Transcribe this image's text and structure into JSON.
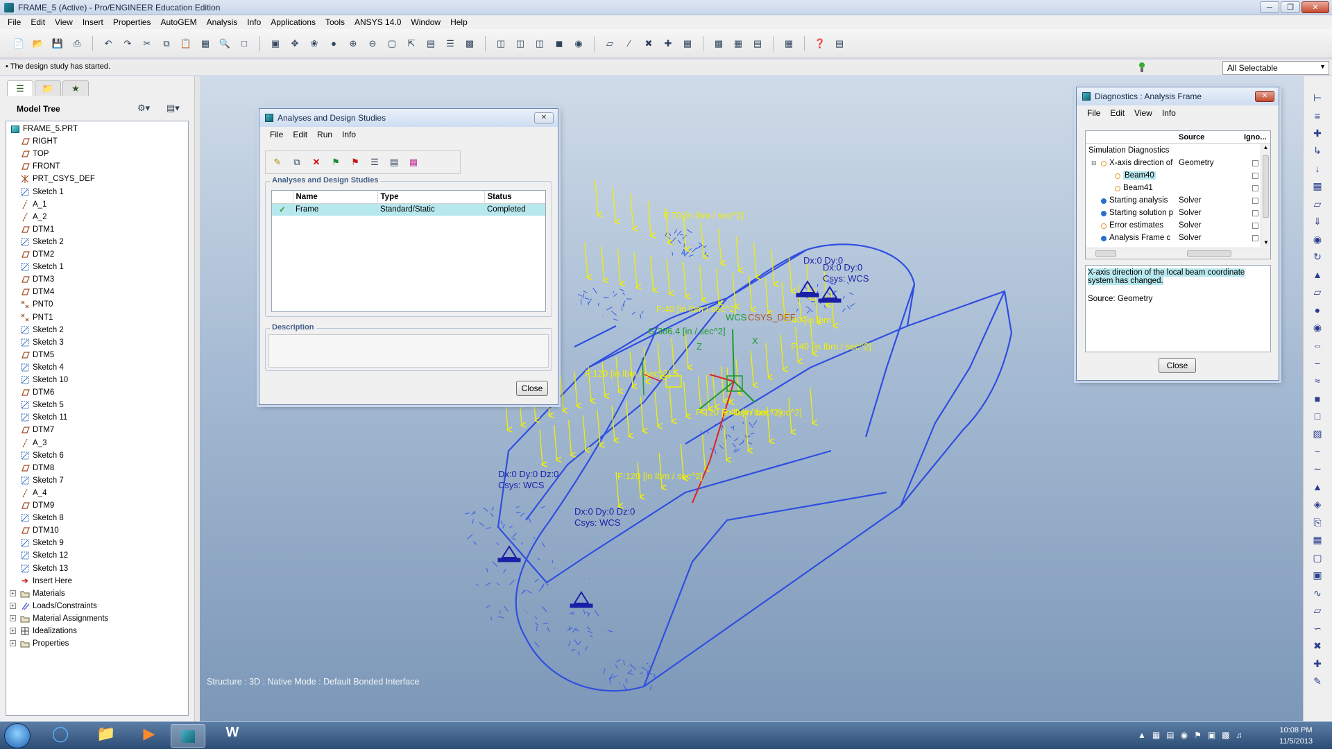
{
  "window": {
    "title": "FRAME_5 (Active) - Pro/ENGINEER Education Edition"
  },
  "menu": [
    "File",
    "Edit",
    "View",
    "Insert",
    "Properties",
    "AutoGEM",
    "Analysis",
    "Info",
    "Applications",
    "Tools",
    "ANSYS 14.0",
    "Window",
    "Help"
  ],
  "message": "The design study has started.",
  "filter": {
    "selected": "All Selectable"
  },
  "model_tree": {
    "header": "Model Tree",
    "items": [
      {
        "label": "FRAME_5.PRT",
        "icon": "part"
      },
      {
        "label": "RIGHT",
        "icon": "datum-plane"
      },
      {
        "label": "TOP",
        "icon": "datum-plane"
      },
      {
        "label": "FRONT",
        "icon": "datum-plane"
      },
      {
        "label": "PRT_CSYS_DEF",
        "icon": "csys"
      },
      {
        "label": "Sketch 1",
        "icon": "sketch"
      },
      {
        "label": "A_1",
        "icon": "axis"
      },
      {
        "label": "A_2",
        "icon": "axis"
      },
      {
        "label": "DTM1",
        "icon": "datum-plane"
      },
      {
        "label": "Sketch 2",
        "icon": "sketch"
      },
      {
        "label": "DTM2",
        "icon": "datum-plane"
      },
      {
        "label": "Sketch 1",
        "icon": "sketch"
      },
      {
        "label": "DTM3",
        "icon": "datum-plane"
      },
      {
        "label": "DTM4",
        "icon": "datum-plane"
      },
      {
        "label": "PNT0",
        "icon": "point"
      },
      {
        "label": "PNT1",
        "icon": "point"
      },
      {
        "label": "Sketch 2",
        "icon": "sketch"
      },
      {
        "label": "Sketch 3",
        "icon": "sketch"
      },
      {
        "label": "DTM5",
        "icon": "datum-plane"
      },
      {
        "label": "Sketch 4",
        "icon": "sketch"
      },
      {
        "label": "Sketch 10",
        "icon": "sketch"
      },
      {
        "label": "DTM6",
        "icon": "datum-plane"
      },
      {
        "label": "Sketch 5",
        "icon": "sketch"
      },
      {
        "label": "Sketch 11",
        "icon": "sketch"
      },
      {
        "label": "DTM7",
        "icon": "datum-plane"
      },
      {
        "label": "A_3",
        "icon": "axis"
      },
      {
        "label": "Sketch 6",
        "icon": "sketch"
      },
      {
        "label": "DTM8",
        "icon": "datum-plane"
      },
      {
        "label": "Sketch 7",
        "icon": "sketch"
      },
      {
        "label": "A_4",
        "icon": "axis"
      },
      {
        "label": "DTM9",
        "icon": "datum-plane"
      },
      {
        "label": "Sketch 8",
        "icon": "sketch"
      },
      {
        "label": "DTM10",
        "icon": "datum-plane"
      },
      {
        "label": "Sketch 9",
        "icon": "sketch"
      },
      {
        "label": "Sketch 12",
        "icon": "sketch"
      },
      {
        "label": "Sketch 13",
        "icon": "sketch"
      },
      {
        "label": "Insert Here",
        "icon": "insert-arrow"
      },
      {
        "label": "Materials",
        "icon": "folder"
      },
      {
        "label": "Loads/Constraints",
        "icon": "loads"
      },
      {
        "label": "Material Assignments",
        "icon": "folder"
      },
      {
        "label": "Idealizations",
        "icon": "idealization"
      },
      {
        "label": "Properties",
        "icon": "folder"
      }
    ]
  },
  "analyses_dialog": {
    "title": "Analyses and Design Studies",
    "menu": [
      "File",
      "Edit",
      "Run",
      "Info"
    ],
    "group_label": "Analyses and Design Studies",
    "columns": [
      "Name",
      "Type",
      "Status"
    ],
    "rows": [
      {
        "name": "Frame",
        "type": "Standard/Static",
        "status": "Completed"
      }
    ],
    "description_label": "Description",
    "close_label": "Close"
  },
  "diagnostics_dialog": {
    "title": "Diagnostics : Analysis Frame",
    "menu": [
      "File",
      "Edit",
      "View",
      "Info"
    ],
    "columns": [
      "Source",
      "Igno..."
    ],
    "rows": [
      {
        "label": "Simulation Diagnostics",
        "source": ""
      },
      {
        "label": "X-axis direction of",
        "source": "Geometry"
      },
      {
        "label": "Beam40",
        "source": ""
      },
      {
        "label": "Beam41",
        "source": ""
      },
      {
        "label": "Starting analysis",
        "source": "Solver"
      },
      {
        "label": "Starting solution p",
        "source": "Solver"
      },
      {
        "label": "Error estimates",
        "source": "Solver"
      },
      {
        "label": "Analysis Frame c",
        "source": "Solver"
      }
    ],
    "detail_text": "X-axis direction of the local beam coordinate system has changed.",
    "detail_source": "Source: Geometry",
    "close_label": "Close"
  },
  "graphics": {
    "labels": {
      "f70": "F:70 [in lbm / sec^2]",
      "f40_top": "F:40 [in lbm",
      "f40_mid": "F:40 [in lbm / sec^2]",
      "f40_right": "F:40 [in lbm / sec^2]",
      "f120_mid": "F:120 [in lbm / sec^2]",
      "f120_bottom": "F:120 [in lbm / sec^2]",
      "f_bottom_right": "F:120 [in lbm / sec^2]",
      "f_bottom_right_2": "F:40 [in lbm / sec^2]",
      "g": "G:386.4 [in / sec^2]",
      "wcs": "WCS",
      "csys_def": "CSYS_DEF",
      "axis_x": "X",
      "axis_z": "Z",
      "c1_a": "Dx:0 Dy:0",
      "c1_b": "Dx:0 Dy:0",
      "c1_c": "Csys: WCS",
      "c2_a": "Dx:0 Dy:0 Dz:0",
      "c2_b": "Csys: WCS",
      "c3_a": "Dx:0 Dy:0 Dz:0",
      "c3_b": "Csys: WCS"
    },
    "status": "Structure : 3D : Native Mode : Default Bonded Interface"
  },
  "taskbar": {
    "time": "10:08 PM",
    "date": "11/5/2013"
  },
  "colors": {
    "beam": "#2f4ee0",
    "load": "#f0f000",
    "constraint": "#1a1fa8",
    "highlight": "#b7e8ee"
  }
}
